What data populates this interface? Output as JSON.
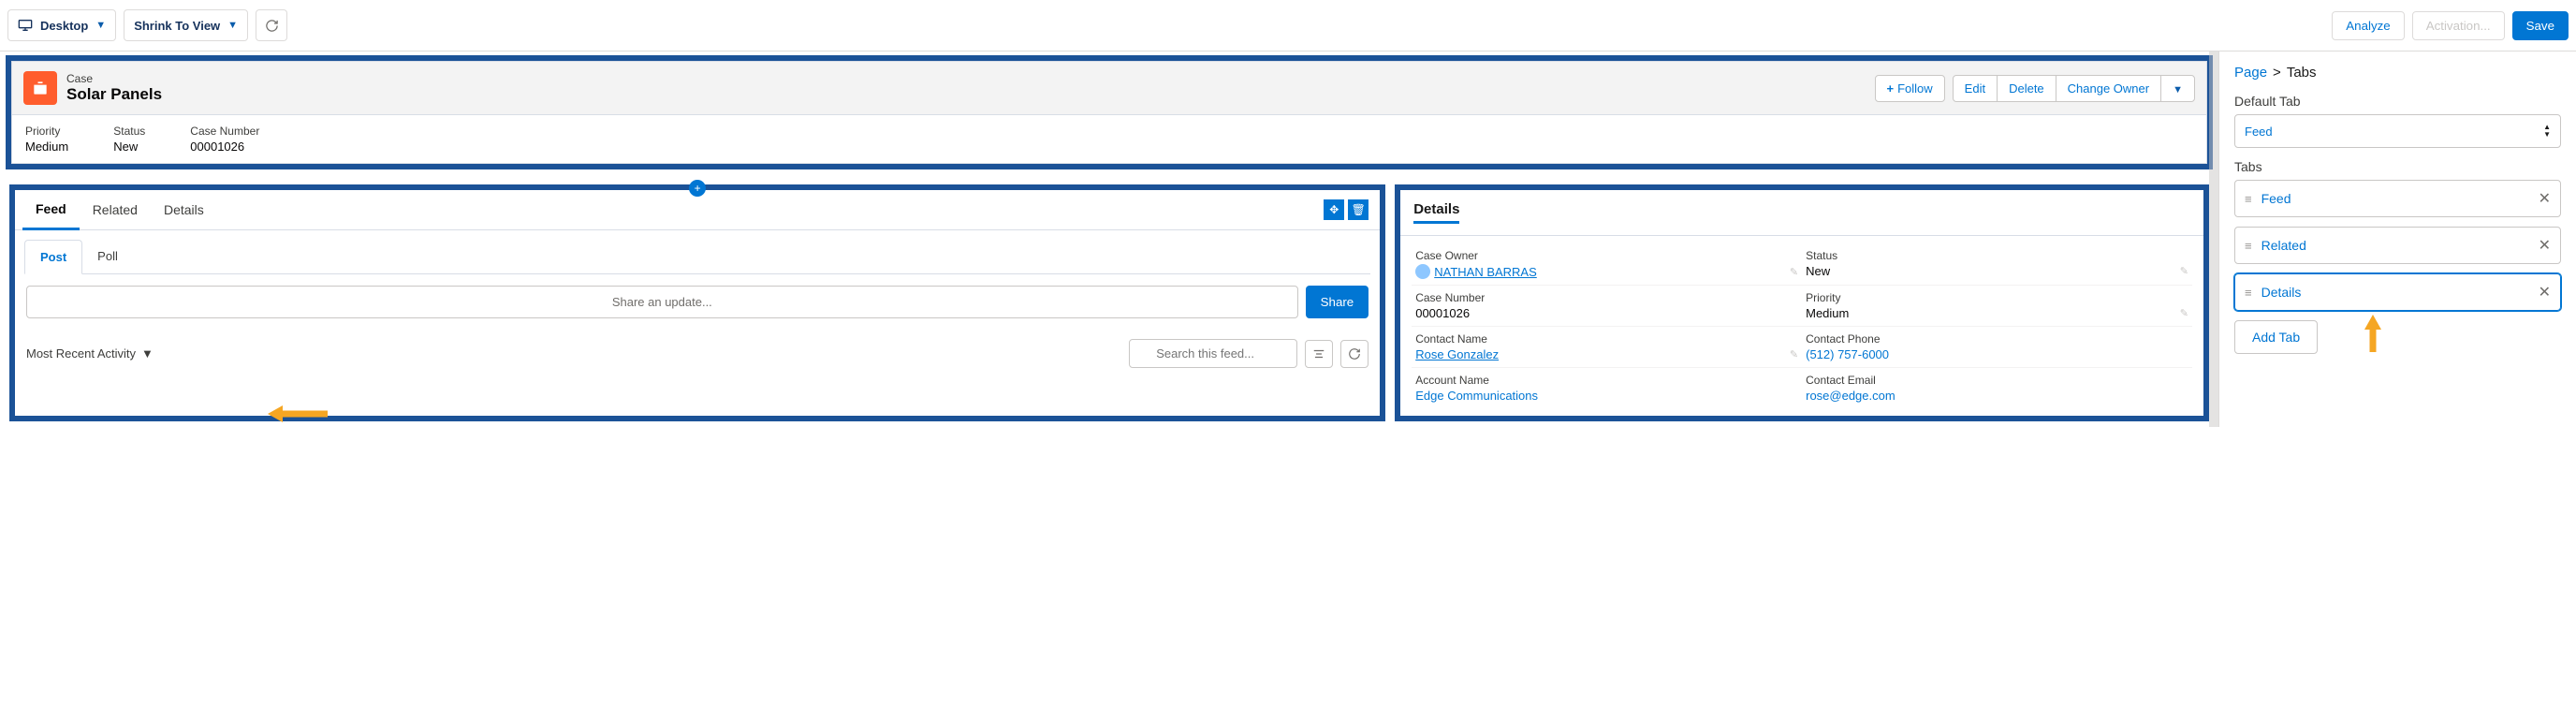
{
  "topbar": {
    "device": "Desktop",
    "zoom": "Shrink To View",
    "analyze": "Analyze",
    "activation": "Activation...",
    "save": "Save"
  },
  "record": {
    "type": "Case",
    "title": "Solar Panels",
    "follow": "Follow",
    "edit": "Edit",
    "delete": "Delete",
    "change_owner": "Change Owner",
    "fields": {
      "priority_label": "Priority",
      "priority_value": "Medium",
      "status_label": "Status",
      "status_value": "New",
      "case_number_label": "Case Number",
      "case_number_value": "00001026"
    }
  },
  "tabs_section": {
    "tabs": [
      "Feed",
      "Related",
      "Details"
    ],
    "active": "Feed"
  },
  "feed": {
    "post_tab": "Post",
    "poll_tab": "Poll",
    "share_placeholder": "Share an update...",
    "share_btn": "Share",
    "most_recent": "Most Recent Activity",
    "search_placeholder": "Search this feed..."
  },
  "details_panel": {
    "title": "Details",
    "rows": {
      "case_owner_l": "Case Owner",
      "case_owner_v": "NATHAN BARRAS",
      "status_l": "Status",
      "status_v": "New",
      "case_number_l": "Case Number",
      "case_number_v": "00001026",
      "priority_l": "Priority",
      "priority_v": "Medium",
      "contact_name_l": "Contact Name",
      "contact_name_v": "Rose Gonzalez",
      "contact_phone_l": "Contact Phone",
      "contact_phone_v": "(512) 757-6000",
      "account_name_l": "Account Name",
      "account_name_v": "Edge Communications",
      "contact_email_l": "Contact Email",
      "contact_email_v": "rose@edge.com"
    }
  },
  "side": {
    "crumb_page": "Page",
    "crumb_sep": ">",
    "crumb_current": "Tabs",
    "default_tab_label": "Default Tab",
    "default_tab_value": "Feed",
    "tabs_label": "Tabs",
    "tab_rows": [
      "Feed",
      "Related",
      "Details"
    ],
    "add_tab": "Add Tab"
  }
}
